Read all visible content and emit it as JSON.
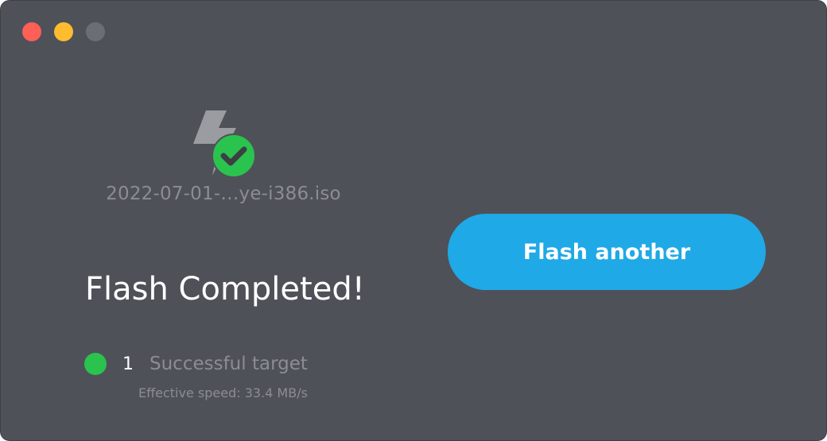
{
  "window": {
    "controls": [
      "close",
      "minimize",
      "maximize"
    ]
  },
  "main": {
    "image_icon": "flash-check-icon",
    "filename": "2022-07-01-…ye-i386.iso",
    "title": "Flash Completed!",
    "results": {
      "count": "1",
      "label": "Successful target",
      "speed": "Effective speed: 33.4 MB/s"
    }
  },
  "actions": {
    "flash_another_label": "Flash another"
  },
  "colors": {
    "background": "#4f5158",
    "accent": "#1fa9e6",
    "success": "#2ac34e",
    "muted_text": "#8b8d93"
  }
}
